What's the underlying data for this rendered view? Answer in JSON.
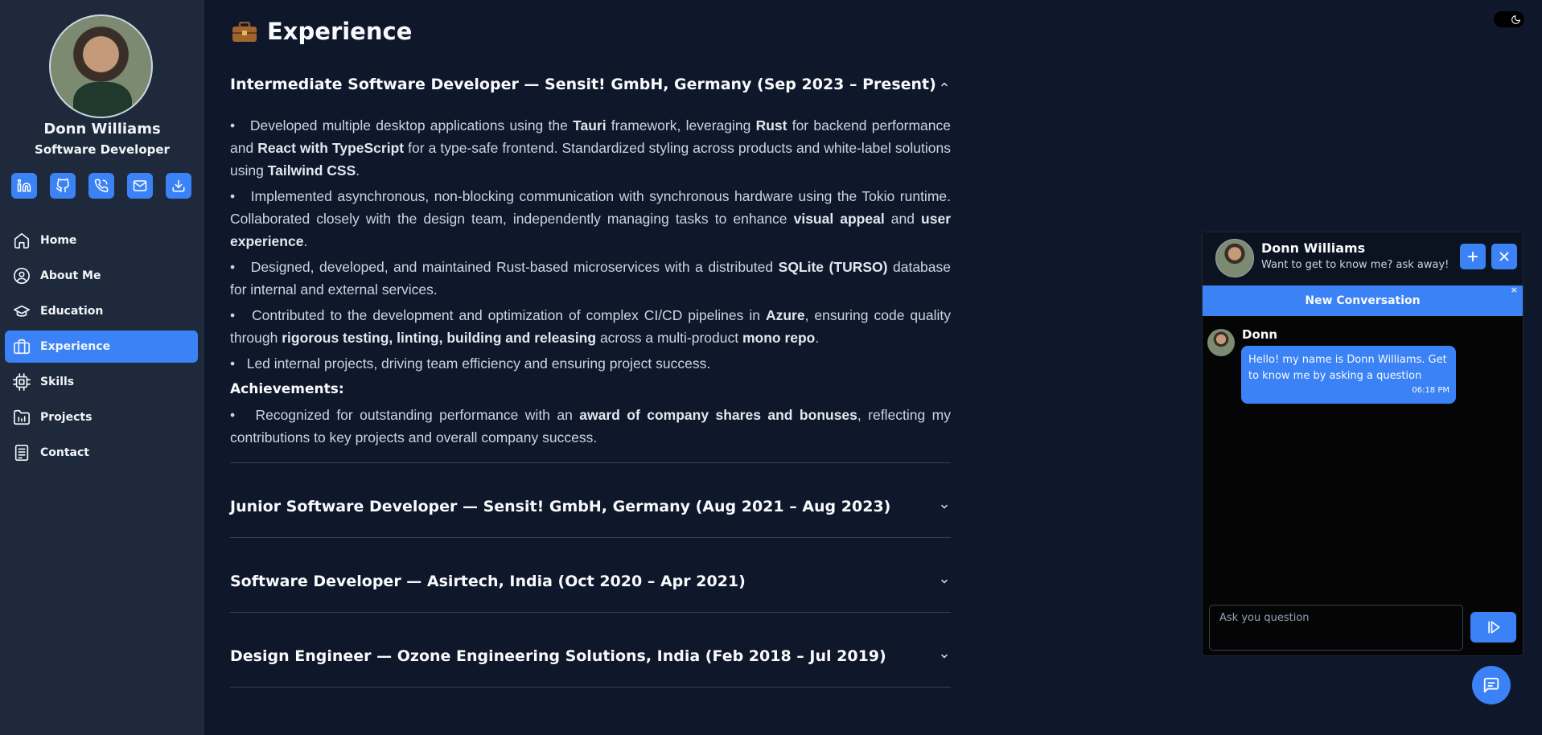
{
  "profile": {
    "name": "Donn Williams",
    "role": "Software Developer"
  },
  "social": [
    {
      "icon": "linkedin-icon"
    },
    {
      "icon": "github-icon"
    },
    {
      "icon": "phone-icon"
    },
    {
      "icon": "mail-icon"
    },
    {
      "icon": "download-icon"
    }
  ],
  "nav": [
    {
      "label": "Home",
      "icon": "home-icon"
    },
    {
      "label": "About Me",
      "icon": "user-icon"
    },
    {
      "label": "Education",
      "icon": "graduation-cap-icon"
    },
    {
      "label": "Experience",
      "icon": "briefcase-icon",
      "active": true
    },
    {
      "label": "Skills",
      "icon": "chip-icon"
    },
    {
      "label": "Projects",
      "icon": "folder-icon"
    },
    {
      "label": "Contact",
      "icon": "document-icon"
    }
  ],
  "page": {
    "title": "Experience",
    "title_icon": "briefcase-emoji-icon"
  },
  "experience": [
    {
      "title": "Intermediate Software Developer — Sensit! GmbH, Germany (Sep 2023 – Present)",
      "expanded": true,
      "bullets": [
        [
          "Developed multiple desktop applications using the ",
          {
            "b": "Tauri"
          },
          " framework, leveraging ",
          {
            "b": "Rust"
          },
          " for backend performance and ",
          {
            "b": "React with TypeScript"
          },
          " for a type-safe frontend. Standardized styling across products and white-label solutions using ",
          {
            "b": "Tailwind CSS"
          },
          "."
        ],
        [
          "Implemented asynchronous, non-blocking communication with synchronous hardware using the Tokio runtime. Collaborated closely with the design team, independently managing tasks to enhance ",
          {
            "b": "visual appeal"
          },
          " and ",
          {
            "b": "user experience"
          },
          "."
        ],
        [
          "Designed, developed, and maintained Rust-based microservices with a distributed ",
          {
            "b": "SQLite (TURSO)"
          },
          " database for internal and external services."
        ],
        [
          "Contributed to the development and optimization of complex CI/CD pipelines in ",
          {
            "b": "Azure"
          },
          ", ensuring code quality through ",
          {
            "b": "rigorous testing, linting, building and releasing"
          },
          " across a multi-product ",
          {
            "b": "mono repo"
          },
          "."
        ],
        [
          "Led internal projects, driving team efficiency and ensuring project success."
        ]
      ],
      "achievements_title": "Achievements:",
      "achievements": [
        [
          "Recognized for outstanding performance with an ",
          {
            "b": "award of company shares and bonuses"
          },
          ", reflecting my contributions to key projects and overall company success."
        ]
      ]
    },
    {
      "title": "Junior Software Developer — Sensit! GmbH, Germany (Aug 2021 – Aug 2023)",
      "expanded": false
    },
    {
      "title": "Software Developer — Asirtech, India (Oct 2020 – Apr 2021)",
      "expanded": false
    },
    {
      "title": "Design Engineer — Ozone Engineering Solutions, India (Feb 2018 – Jul 2019)",
      "expanded": false
    }
  ],
  "chat": {
    "name": "Donn Williams",
    "subtitle": "Want to get to know me? ask away!",
    "new_conversation": "New Conversation",
    "close_banner": "×",
    "message": {
      "sender": "Donn",
      "text": "Hello! my name is Donn Williams. Get to know me by asking a question",
      "time": "06:18 PM"
    },
    "input_placeholder": "Ask you question"
  },
  "colors": {
    "accent": "#3b82f6",
    "sidebar": "#1e293b",
    "background": "#0f172a"
  }
}
